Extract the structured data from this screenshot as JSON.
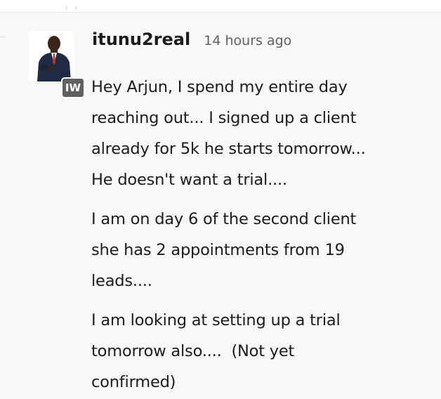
{
  "message": {
    "author": "itunu2real",
    "timestamp": "14 hours ago",
    "badge": "IW",
    "paragraphs": [
      {
        "lines": [
          "Hey Arjun, I spend my entire day",
          "reaching out... I signed up a client",
          "already for 5k he starts tomorrow...",
          "He doesn't want a trial...."
        ]
      },
      {
        "lines": [
          "I am on day 6 of the second client",
          "she has 2 appointments from 19",
          "leads...."
        ]
      },
      {
        "lines": [
          "I am looking at setting up a trial",
          "tomorrow also....  (Not yet",
          "confirmed)"
        ]
      }
    ]
  },
  "colors": {
    "background": "#f8f8f8",
    "text": "#1d1c1d",
    "muted": "#616061",
    "badge": "#616061"
  },
  "icons": {
    "avatar": "user-avatar-photo",
    "badge": "workspace-badge-icon"
  }
}
